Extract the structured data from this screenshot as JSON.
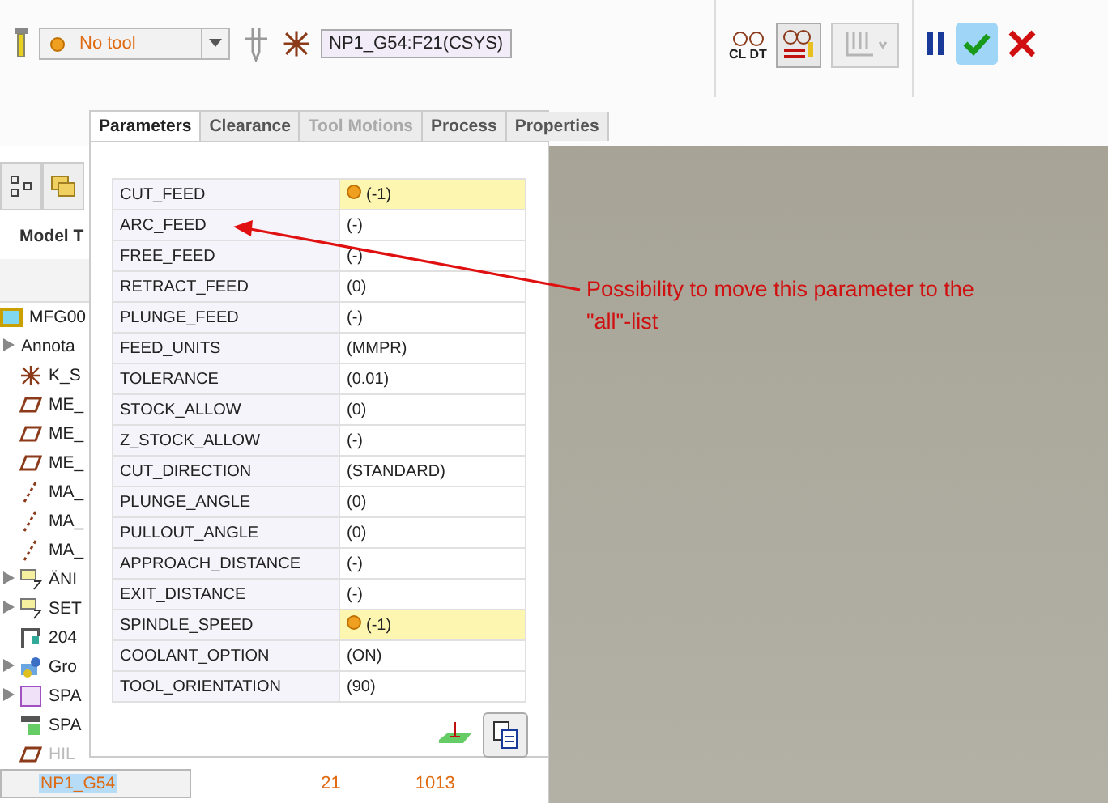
{
  "toolbar": {
    "tool_select": {
      "value": "No tool"
    },
    "csys_field": {
      "value": "NP1_G54:F21(CSYS)"
    },
    "cldt_label": "CL DT"
  },
  "left_panel": {
    "tab_label": "Model T",
    "tree": [
      {
        "text": "MFG00",
        "kind": "assembly",
        "expandable": false,
        "disabled": false,
        "selected": false
      },
      {
        "text": "Annota",
        "kind": "none",
        "expandable": true,
        "disabled": false,
        "selected": false
      },
      {
        "text": "K_S",
        "kind": "csys",
        "expandable": false,
        "disabled": false,
        "selected": false
      },
      {
        "text": "ME_",
        "kind": "plane",
        "expandable": false,
        "disabled": false,
        "selected": false
      },
      {
        "text": "ME_",
        "kind": "plane",
        "expandable": false,
        "disabled": false,
        "selected": false
      },
      {
        "text": "ME_",
        "kind": "plane",
        "expandable": false,
        "disabled": false,
        "selected": false
      },
      {
        "text": "MA_",
        "kind": "axis",
        "expandable": false,
        "disabled": false,
        "selected": false
      },
      {
        "text": "MA_",
        "kind": "axis",
        "expandable": false,
        "disabled": false,
        "selected": false
      },
      {
        "text": "MA_",
        "kind": "axis",
        "expandable": false,
        "disabled": false,
        "selected": false
      },
      {
        "text": "ÄNI",
        "kind": "setup",
        "expandable": true,
        "disabled": false,
        "selected": false
      },
      {
        "text": "SET",
        "kind": "setup",
        "expandable": true,
        "disabled": false,
        "selected": false
      },
      {
        "text": "204",
        "kind": "machine",
        "expandable": false,
        "disabled": false,
        "selected": false
      },
      {
        "text": "Gro",
        "kind": "group",
        "expandable": true,
        "disabled": false,
        "selected": false
      },
      {
        "text": "SPA",
        "kind": "fixture",
        "expandable": true,
        "disabled": false,
        "selected": false
      },
      {
        "text": "SPA",
        "kind": "workpiece",
        "expandable": false,
        "disabled": false,
        "selected": false
      },
      {
        "text": "HIL",
        "kind": "plane",
        "expandable": false,
        "disabled": true,
        "selected": false
      },
      {
        "text": "NP1_G54",
        "kind": "csys",
        "expandable": false,
        "disabled": false,
        "selected": true,
        "column_2": "21",
        "column_3": "1013"
      }
    ]
  },
  "dialog": {
    "tabs": [
      {
        "label": "Parameters",
        "selected": true,
        "disabled": false
      },
      {
        "label": "Clearance",
        "selected": false,
        "disabled": false
      },
      {
        "label": "Tool Motions",
        "selected": false,
        "disabled": true
      },
      {
        "label": "Process",
        "selected": false,
        "disabled": false
      },
      {
        "label": "Properties",
        "selected": false,
        "disabled": false
      }
    ],
    "parameters": [
      {
        "name": "CUT_FEED",
        "value": "(-1)",
        "highlighted": true
      },
      {
        "name": "ARC_FEED",
        "value": "(-)",
        "highlighted": false
      },
      {
        "name": "FREE_FEED",
        "value": "(-)",
        "highlighted": false
      },
      {
        "name": "RETRACT_FEED",
        "value": "(0)",
        "highlighted": false
      },
      {
        "name": "PLUNGE_FEED",
        "value": "(-)",
        "highlighted": false
      },
      {
        "name": "FEED_UNITS",
        "value": "(MMPR)",
        "highlighted": false
      },
      {
        "name": "TOLERANCE",
        "value": "(0.01)",
        "highlighted": false
      },
      {
        "name": "STOCK_ALLOW",
        "value": "(0)",
        "highlighted": false
      },
      {
        "name": "Z_STOCK_ALLOW",
        "value": "(-)",
        "highlighted": false
      },
      {
        "name": "CUT_DIRECTION",
        "value": "(STANDARD)",
        "highlighted": false
      },
      {
        "name": "PLUNGE_ANGLE",
        "value": "(0)",
        "highlighted": false
      },
      {
        "name": "PULLOUT_ANGLE",
        "value": "(0)",
        "highlighted": false
      },
      {
        "name": "APPROACH_DISTANCE",
        "value": "(-)",
        "highlighted": false
      },
      {
        "name": "EXIT_DISTANCE",
        "value": "(-)",
        "highlighted": false
      },
      {
        "name": "SPINDLE_SPEED",
        "value": "(-1)",
        "highlighted": true
      },
      {
        "name": "COOLANT_OPTION",
        "value": "(ON)",
        "highlighted": false
      },
      {
        "name": "TOOL_ORIENTATION",
        "value": "(90)",
        "highlighted": false
      }
    ]
  },
  "annotation": {
    "text": "Possibility to move this parameter to the \"all\"-list"
  }
}
